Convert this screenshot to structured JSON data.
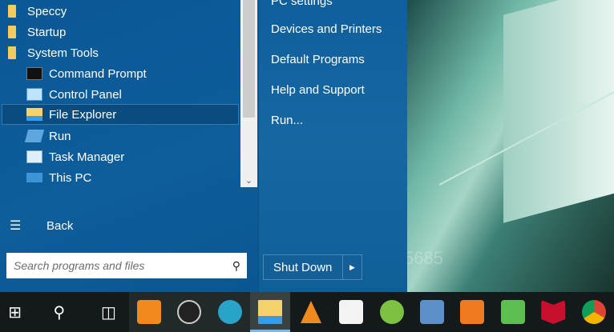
{
  "programs": {
    "folders": [
      "Speccy",
      "Startup",
      "System Tools"
    ],
    "items": [
      "Command Prompt",
      "Control Panel",
      "File Explorer",
      "Run",
      "Task Manager",
      "This PC"
    ],
    "selected": "File Explorer",
    "back_label": "Back"
  },
  "search": {
    "placeholder": "Search programs and files"
  },
  "right_menu": [
    "PC settings",
    "Devices and Printers",
    "Default Programs",
    "Help and Support",
    "Run..."
  ],
  "shutdown": {
    "label": "Shut Down"
  },
  "wallpaper_text": "5685",
  "taskbar": [
    "Start",
    "Search",
    "Task View",
    "Clock app",
    "OBS Studio",
    "Blue circle app",
    "File Explorer",
    "VLC media player",
    "Microsoft Store",
    "Greenshot",
    "On-Screen Keyboard",
    "Media Player",
    "Spreadsheet app",
    "McAfee",
    "Google Chrome"
  ]
}
